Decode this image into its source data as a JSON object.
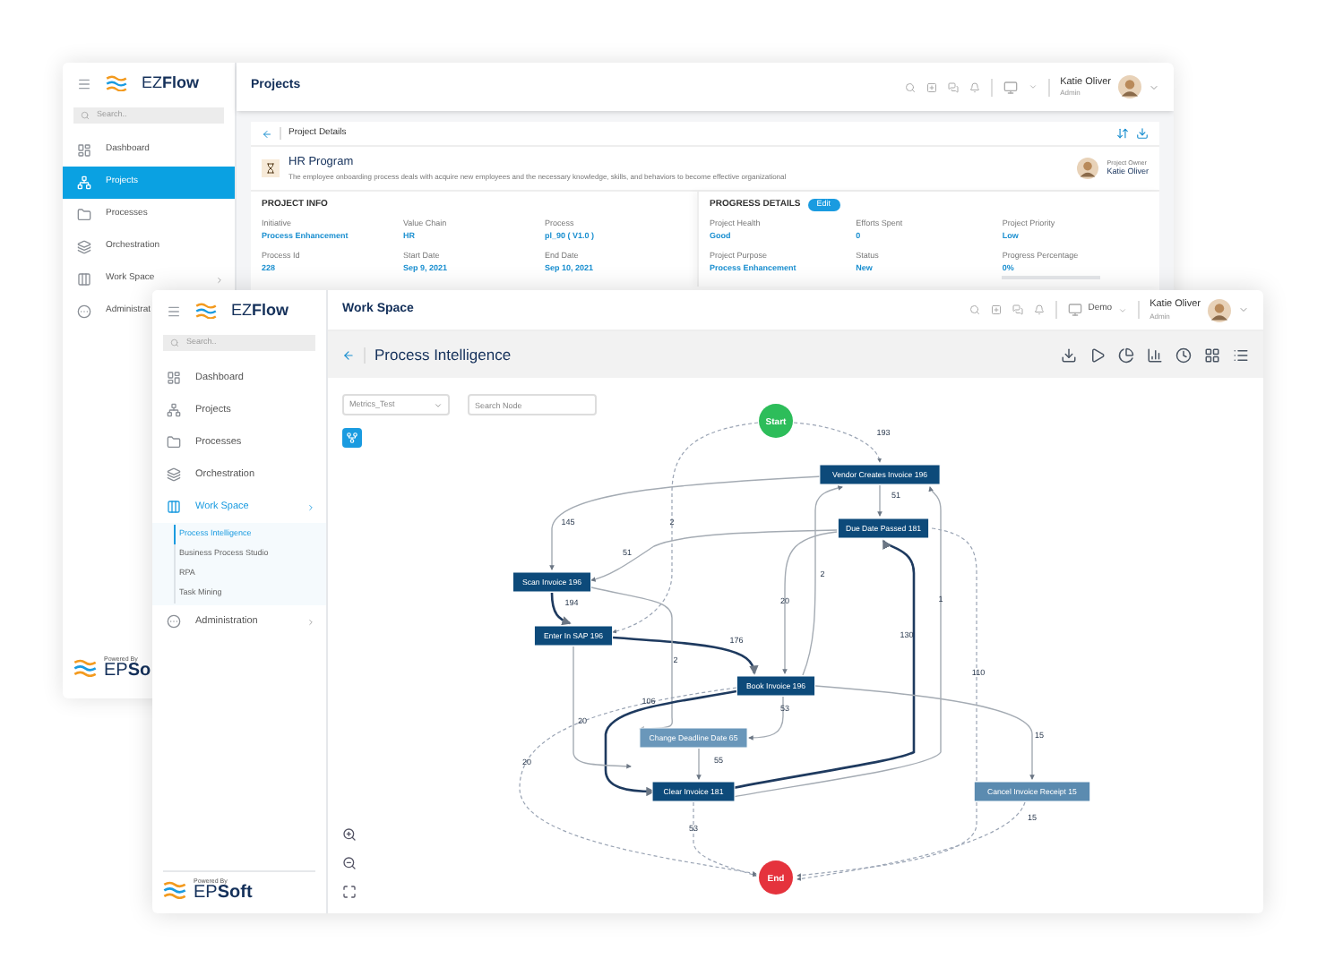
{
  "back_window": {
    "app_name": "EZ**Flow**",
    "search": {
      "placeholder": "Search.."
    },
    "sidebar": {
      "items": [
        {
          "label": "Dashboard",
          "selected": false
        },
        {
          "label": "Projects",
          "selected": true
        },
        {
          "label": "Processes",
          "selected": false
        },
        {
          "label": "Orchestration",
          "selected": false
        },
        {
          "label": "Work Space",
          "selected": false,
          "expanded": false
        },
        {
          "label": "Administrat",
          "selected": false
        }
      ]
    },
    "powered_by": "Powered By",
    "brand": "EP**So**",
    "page_title": "Projects",
    "user": {
      "name": "Katie Oliver",
      "role": "Admin"
    },
    "card": {
      "title": "Project Details",
      "program": {
        "name": "HR Program",
        "description": "The employee onboarding process deals with acquire new employees and the necessary knowledge, skills, and behaviors to become effective organizational"
      },
      "owner": {
        "label": "Project Owner",
        "name": "Katie Oliver"
      },
      "project_info": {
        "heading": "PROJECT INFO",
        "fields": [
          {
            "label": "Initiative",
            "value": "Process Enhancement"
          },
          {
            "label": "Value Chain",
            "value": "HR"
          },
          {
            "label": "Process",
            "value": "pl_90 ( V1.0 )"
          },
          {
            "label": "Process Id",
            "value": "228"
          },
          {
            "label": "Start Date",
            "value": "Sep 9, 2021"
          },
          {
            "label": "End Date",
            "value": "Sep 10, 2021"
          }
        ]
      },
      "progress_details": {
        "heading": "PROGRESS DETAILS",
        "edit_button": "Edit",
        "fields": [
          {
            "label": "Project Health",
            "value": "Good"
          },
          {
            "label": "Efforts Spent",
            "value": "0"
          },
          {
            "label": "Project Priority",
            "value": "Low"
          },
          {
            "label": "Project Purpose",
            "value": "Process Enhancement"
          },
          {
            "label": "Status",
            "value": "New"
          },
          {
            "label": "Progress Percentage",
            "value": "0%",
            "level": 0
          }
        ]
      }
    }
  },
  "front_window": {
    "app_name": "EZ**Flow**",
    "search": {
      "placeholder": "Search.."
    },
    "sidebar": {
      "items": [
        {
          "label": "Dashboard",
          "selected": false
        },
        {
          "label": "Projects",
          "selected": false
        },
        {
          "label": "Processes",
          "selected": false
        },
        {
          "label": "Orchestration",
          "selected": false
        },
        {
          "label": "Work Space",
          "selected": true,
          "expanded": true,
          "children": [
            {
              "label": "Process Intelligence",
              "selected": true
            },
            {
              "label": "Business Process Studio",
              "selected": false
            },
            {
              "label": "RPA",
              "selected": false
            },
            {
              "label": "Task Mining",
              "selected": false
            }
          ]
        },
        {
          "label": "Administration",
          "selected": false,
          "expanded": false
        }
      ]
    },
    "powered_by": "Powered By",
    "brand": "EP**Soft**",
    "page_title": "Work Space",
    "workspace": "Demo",
    "user": {
      "name": "Katie Oliver",
      "role": "Admin"
    },
    "view_title": "Process Intelligence",
    "filters": {
      "metric": "Metrics_Test",
      "search_placeholder": "Search Node"
    },
    "graph": {
      "nodes": [
        {
          "kind": "start",
          "label": "Start",
          "color": "#2dbd5a"
        },
        {
          "kind": "activity",
          "label": "Vendor Creates Invoice 196",
          "color": "#0d4a7a"
        },
        {
          "kind": "activity",
          "label": "Due Date Passed 181",
          "color": "#0d4a7a"
        },
        {
          "kind": "activity",
          "label": "Scan Invoice 196",
          "color": "#0d4a7a"
        },
        {
          "kind": "activity",
          "label": "Enter In SAP 196",
          "color": "#0d4a7a"
        },
        {
          "kind": "activity",
          "label": "Book Invoice 196",
          "color": "#0d4a7a"
        },
        {
          "kind": "activity",
          "label": "Change Deadline Date 65",
          "color": "#6a97ba"
        },
        {
          "kind": "activity",
          "label": "Clear Invoice 181",
          "color": "#0d4a7a"
        },
        {
          "kind": "activity",
          "label": "Cancel Invoice Receipt 15",
          "color": "#5b8bb0"
        },
        {
          "kind": "end",
          "label": "End",
          "color": "#e5333d"
        }
      ],
      "edge_labels": [
        "193",
        "2",
        "145",
        "51",
        "51",
        "194",
        "176",
        "2",
        "2",
        "20",
        "130",
        "1",
        "110",
        "106",
        "53",
        "20",
        "55",
        "20",
        "53",
        "15",
        "15"
      ]
    }
  }
}
